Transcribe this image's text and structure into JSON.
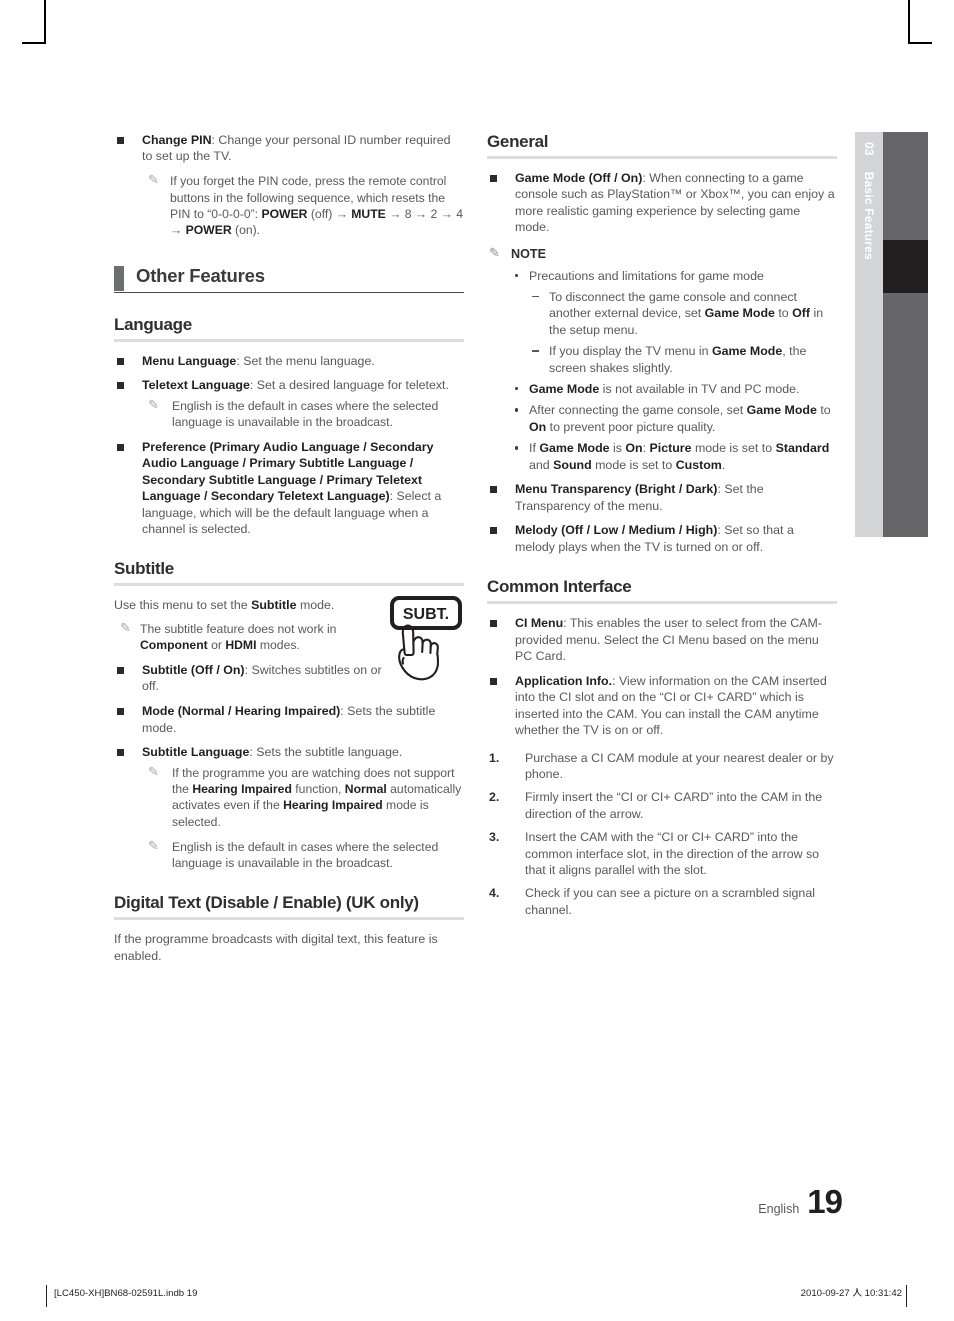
{
  "page": {
    "number": "19",
    "language_label": "English",
    "chapter_number": "03",
    "chapter_title": "Basic Features"
  },
  "footer": {
    "file": "[LC450-XH]BN68-02591L.indb   19",
    "timestamp": "2010-09-27   ㆟ 10:31:42"
  },
  "left_column": {
    "change_pin": {
      "bold": "Change PIN",
      "text": ": Change your personal ID number required to set up the TV."
    },
    "change_pin_note": "If you forget the PIN code, press the remote control buttons in the following sequence, which resets the PIN to “0-0-0-0”: POWER (off) → MUTE → 8 → 2 → 4 → POWER (on).",
    "other_features_heading": "Other Features",
    "language_heading": "Language",
    "menu_language": {
      "bold": "Menu Language",
      "text": ": Set the menu language."
    },
    "teletext_language": {
      "bold": "Teletext Language",
      "text": ": Set a desired language for teletext."
    },
    "teletext_note": "English is the default in cases where the selected language is unavailable in the broadcast.",
    "preference": {
      "bold": "Preference (Primary Audio Language / Secondary Audio Language / Primary Subtitle Language / Secondary Subtitle Language / Primary Teletext Language / Secondary Teletext Language)",
      "text": ": Select a language, which will be the default language when a channel is selected."
    },
    "subtitle_heading": "Subtitle",
    "subtitle_intro_pre": "Use this menu to set the ",
    "subtitle_intro_bold": "Subtitle",
    "subtitle_intro_post": " mode.",
    "subtitle_note_1": "The subtitle feature does not work in Component or HDMI modes.",
    "subtitle_onoff": {
      "bold": "Subtitle (Off / On)",
      "text": ": Switches subtitles on or off."
    },
    "mode": {
      "bold": "Mode (Normal / Hearing Impaired)",
      "text": ": Sets the subtitle mode."
    },
    "subtitle_language": {
      "bold": "Subtitle Language",
      "text": ": Sets the subtitle language."
    },
    "subtitle_language_note_1": "If the programme you are watching does not support the Hearing Impaired function, Normal automatically activates even if the Hearing Impaired mode is selected.",
    "subtitle_language_note_2": "English is the default in cases where the selected language is unavailable in the broadcast.",
    "digital_text_heading": "Digital Text (Disable / Enable) (UK only)",
    "digital_text_body": "If the programme broadcasts with digital text, this feature is enabled.",
    "remote_key_label": "SUBT."
  },
  "right_column": {
    "general_heading": "General",
    "game_mode": {
      "bold": "Game Mode (Off / On)",
      "text": ": When connecting to a game console such as PlayStation™ or Xbox™, you can enjoy a more realistic gaming experience by selecting game mode."
    },
    "note_label": "NOTE",
    "note_1": "Precautions and limitations for game mode",
    "note_1_sub_1": "To disconnect the game console and connect another external device, set Game Mode to Off in the setup menu.",
    "note_1_sub_2": "If you display the TV menu in Game Mode, the screen shakes slightly.",
    "note_2": "Game Mode is not available in TV and PC mode.",
    "note_3": "After connecting the game console, set Game Mode to On to prevent poor picture quality.",
    "note_4": "If Game Mode is On: Picture mode is set to Standard and Sound mode is set to Custom.",
    "menu_transparency": {
      "bold": "Menu Transparency (Bright / Dark)",
      "text": ": Set the Transparency of the menu."
    },
    "melody": {
      "bold": "Melody (Off / Low / Medium / High)",
      "text": ": Set so that a melody plays when the TV is turned on or off."
    },
    "common_interface_heading": "Common Interface",
    "ci_menu": {
      "bold": "CI Menu",
      "text": ":  This enables the user to select from the CAM-provided menu. Select the CI Menu based on the menu PC Card."
    },
    "application_info": {
      "bold": "Application Info.",
      "text": ": View information on the CAM inserted into the CI slot and on the “CI or CI+ CARD” which is inserted into the CAM. You can install the CAM anytime whether the TV is on or off."
    },
    "steps": [
      {
        "num": "1.",
        "text": "Purchase a CI CAM module at your nearest dealer or by phone."
      },
      {
        "num": "2.",
        "text": "Firmly insert the “CI or CI+ CARD” into the CAM in the direction of the arrow."
      },
      {
        "num": "3.",
        "text": "Insert the CAM with the “CI or CI+ CARD” into the common interface slot, in the direction of the arrow so that it aligns parallel with the slot."
      },
      {
        "num": "4.",
        "text": "Check if you can see a picture on a scrambled signal channel."
      }
    ]
  },
  "icons": {
    "note_pencil": "✎",
    "bullet_square": "square-bullet",
    "arrow_right": "→"
  },
  "colors": {
    "body_text": "#58595b",
    "bold_text": "#231f20",
    "heading_bar": "#6d6e70",
    "sub_rule": "#dcdddf",
    "tab_strip": "#d3d4d6",
    "tab_bar": "#666668",
    "tab_active": "#231f20"
  }
}
